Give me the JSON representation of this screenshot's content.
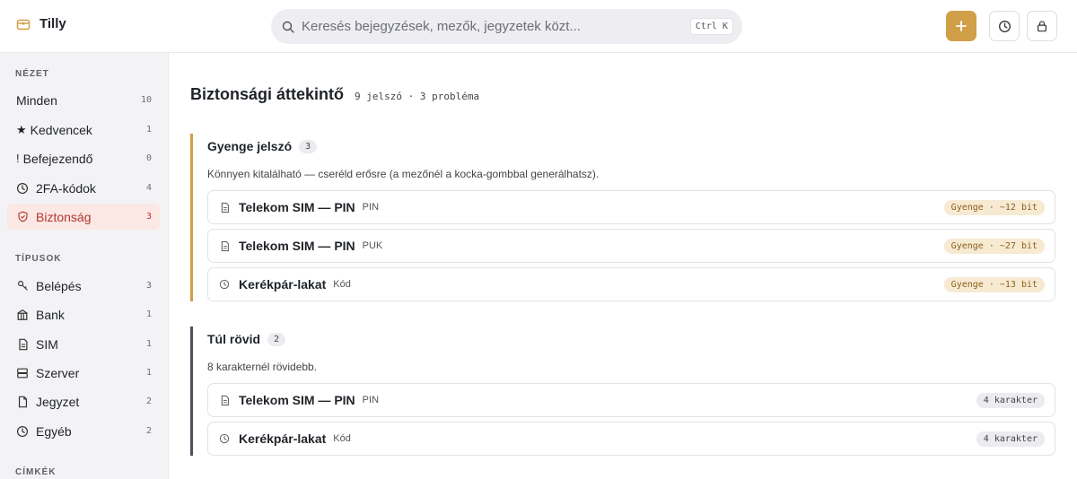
{
  "app": {
    "name": "Tilly"
  },
  "search": {
    "placeholder": "Keresés bejegyzések, mezők, jegyzetek közt...",
    "shortcut": "Ctrl K"
  },
  "sidebar": {
    "view_title": "NÉZET",
    "view_items": [
      {
        "label": "Minden",
        "count": "10",
        "icon": "none"
      },
      {
        "label": "Kedvencek",
        "count": "1",
        "icon": "star-icon"
      },
      {
        "label": "Befejezendő",
        "count": "0",
        "icon": "exclamation-icon"
      },
      {
        "label": "2FA-kódok",
        "count": "4",
        "icon": "clock-icon"
      },
      {
        "label": "Biztonság",
        "count": "3",
        "icon": "shield-icon",
        "active": true
      }
    ],
    "types_title": "TÍPUSOK",
    "type_items": [
      {
        "label": "Belépés",
        "count": "3",
        "icon": "key-icon"
      },
      {
        "label": "Bank",
        "count": "1",
        "icon": "bank-icon"
      },
      {
        "label": "SIM",
        "count": "1",
        "icon": "sim-icon"
      },
      {
        "label": "Szerver",
        "count": "1",
        "icon": "server-icon"
      },
      {
        "label": "Jegyzet",
        "count": "2",
        "icon": "note-icon"
      },
      {
        "label": "Egyéb",
        "count": "2",
        "icon": "clock-icon"
      }
    ],
    "tags_title": "CÍMKÉK"
  },
  "main": {
    "title": "Biztonsági áttekintő",
    "meta": "9 jelszó · 3 probléma",
    "groups": [
      {
        "title": "Gyenge jelszó",
        "count": "3",
        "desc": "Könnyen kitalálható — cseréld erősre (a mezőnél a kocka-gombbal generálhatsz).",
        "rows": [
          {
            "name": "Telekom SIM — PIN",
            "sub": "PIN",
            "tag": "Gyenge · ~12 bit",
            "icon": "sim-icon"
          },
          {
            "name": "Telekom SIM — PIN",
            "sub": "PUK",
            "tag": "Gyenge · ~27 bit",
            "icon": "sim-icon"
          },
          {
            "name": "Kerékpár-lakat",
            "sub": "Kód",
            "tag": "Gyenge · ~13 bit",
            "icon": "clock-icon"
          }
        ]
      },
      {
        "title": "Túl rövid",
        "count": "2",
        "desc": "8 karakternél rövidebb.",
        "rows": [
          {
            "name": "Telekom SIM — PIN",
            "sub": "PIN",
            "tag": "4 karakter",
            "icon": "sim-icon"
          },
          {
            "name": "Kerékpár-lakat",
            "sub": "Kód",
            "tag": "4 karakter",
            "icon": "clock-icon"
          }
        ]
      }
    ]
  },
  "colors": {
    "accent": "#d19f47",
    "danger": "#b2362c",
    "dark_bar": "#4d4f5c"
  }
}
